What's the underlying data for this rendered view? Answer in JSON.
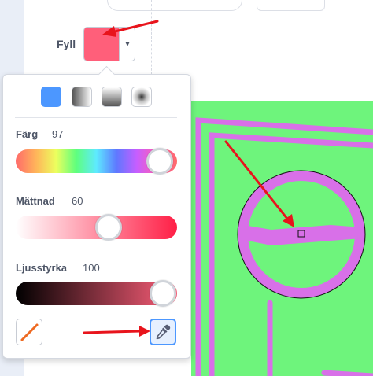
{
  "fill": {
    "label": "Fyll",
    "swatch_color": "#ff5f7a",
    "caret": "▾"
  },
  "color_panel": {
    "modes": [
      "solid",
      "gradient-horizontal",
      "gradient-vertical",
      "gradient-radial"
    ],
    "selected_mode": "solid",
    "sliders": {
      "hue": {
        "label": "Färg",
        "value": "97"
      },
      "saturation": {
        "label": "Mättnad",
        "value": "60"
      },
      "brightness": {
        "label": "Ljusstyrka",
        "value": "100"
      }
    },
    "no_fill_icon": "no-fill-slash-icon",
    "eyedropper_icon": "eyedropper-icon",
    "eyedropper_active": true
  },
  "canvas": {
    "background_color": "#6ef47c",
    "stroke_color": "#d870e8"
  },
  "annotations": {
    "arrow_color": "#e8141c"
  }
}
